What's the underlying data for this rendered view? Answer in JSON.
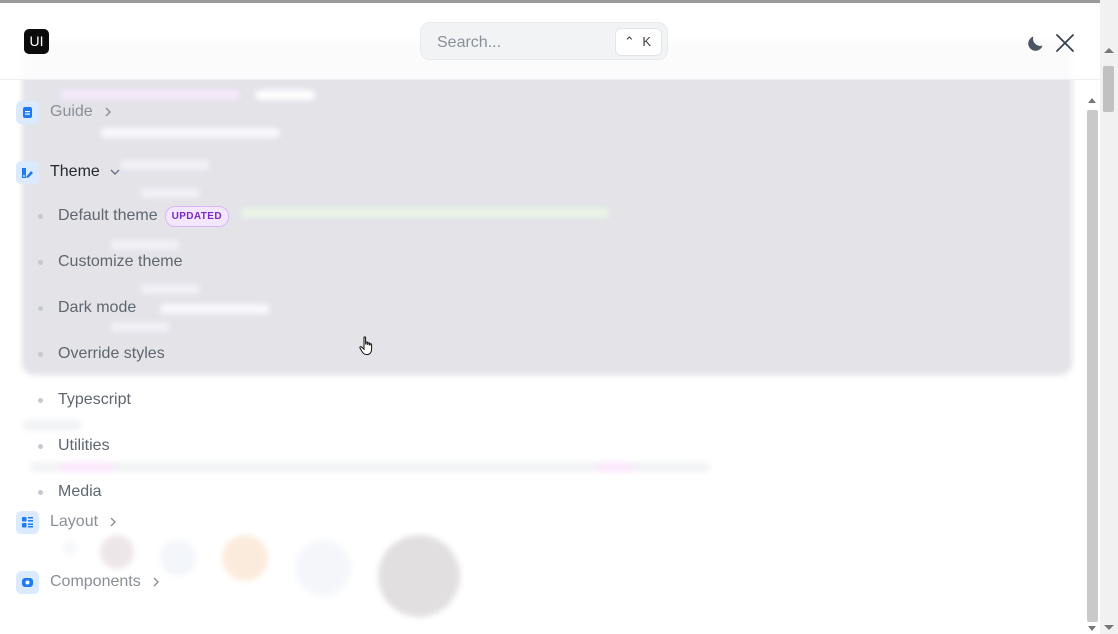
{
  "header": {
    "logo_text": "UI",
    "search": {
      "placeholder": "Search...",
      "shortcut": "⌃ K"
    },
    "icons": {
      "theme_toggle": "moon-icon",
      "close": "close-icon"
    }
  },
  "nav": {
    "items": [
      {
        "label": "Guide",
        "icon": "guide-icon",
        "expanded": false
      },
      {
        "label": "Theme",
        "icon": "theme-icon",
        "expanded": true,
        "children": [
          {
            "label": "Default theme",
            "badge": "UPDATED"
          },
          {
            "label": "Customize theme"
          },
          {
            "label": "Dark mode"
          },
          {
            "label": "Override styles"
          },
          {
            "label": "Typescript"
          },
          {
            "label": "Utilities"
          },
          {
            "label": "Media"
          }
        ]
      },
      {
        "label": "Layout",
        "icon": "layout-icon",
        "expanded": false
      },
      {
        "label": "Components",
        "icon": "components-icon",
        "expanded": false
      }
    ]
  },
  "colors": {
    "accent": "#1e7bf5",
    "accent_bg": "#dbeafe",
    "badge_text": "#7a2bc2",
    "badge_bg": "#f3e6ff"
  }
}
